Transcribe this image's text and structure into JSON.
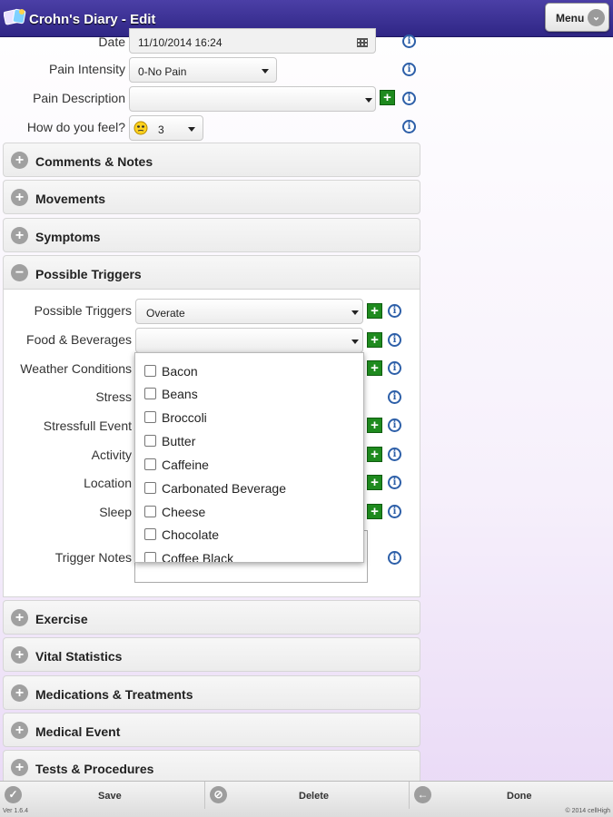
{
  "header": {
    "title": "Crohn's Diary - Edit",
    "menu_label": "Menu"
  },
  "form": {
    "date_label": "Date",
    "date_value": "11/10/2014 16:24",
    "pain_intensity_label": "Pain Intensity",
    "pain_intensity_value": "0-No Pain",
    "pain_description_label": "Pain Description",
    "pain_description_value": "",
    "feel_label": "How do you feel?",
    "feel_value": "3"
  },
  "sections": [
    {
      "title": "Comments & Notes",
      "expanded": false
    },
    {
      "title": "Movements",
      "expanded": false
    },
    {
      "title": "Symptoms",
      "expanded": false
    },
    {
      "title": "Possible Triggers",
      "expanded": true
    },
    {
      "title": "Exercise",
      "expanded": false
    },
    {
      "title": "Vital Statistics",
      "expanded": false
    },
    {
      "title": "Medications & Treatments",
      "expanded": false
    },
    {
      "title": "Medical Event",
      "expanded": false
    },
    {
      "title": "Tests & Procedures",
      "expanded": false
    }
  ],
  "triggers": {
    "possible_triggers_label": "Possible Triggers",
    "possible_triggers_value": "Overate",
    "food_label": "Food & Beverages",
    "weather_label": "Weather Conditions",
    "stress_label": "Stress",
    "stressful_event_label": "Stressfull Event",
    "activity_label": "Activity",
    "location_label": "Location",
    "sleep_label": "Sleep",
    "notes_label": "Trigger Notes"
  },
  "food_options": [
    "Bacon",
    "Beans",
    "Broccoli",
    "Butter",
    "Caffeine",
    "Carbonated Beverage",
    "Cheese",
    "Chocolate",
    "Coffee Black"
  ],
  "footer": {
    "save": "Save",
    "delete": "Delete",
    "done": "Done",
    "version": "Ver 1.6.4",
    "copyright": "© 2014 cellHigh"
  },
  "colors": {
    "header": "#2f2685",
    "add_button": "#1e8a1e",
    "info": "#2d5fa8"
  }
}
